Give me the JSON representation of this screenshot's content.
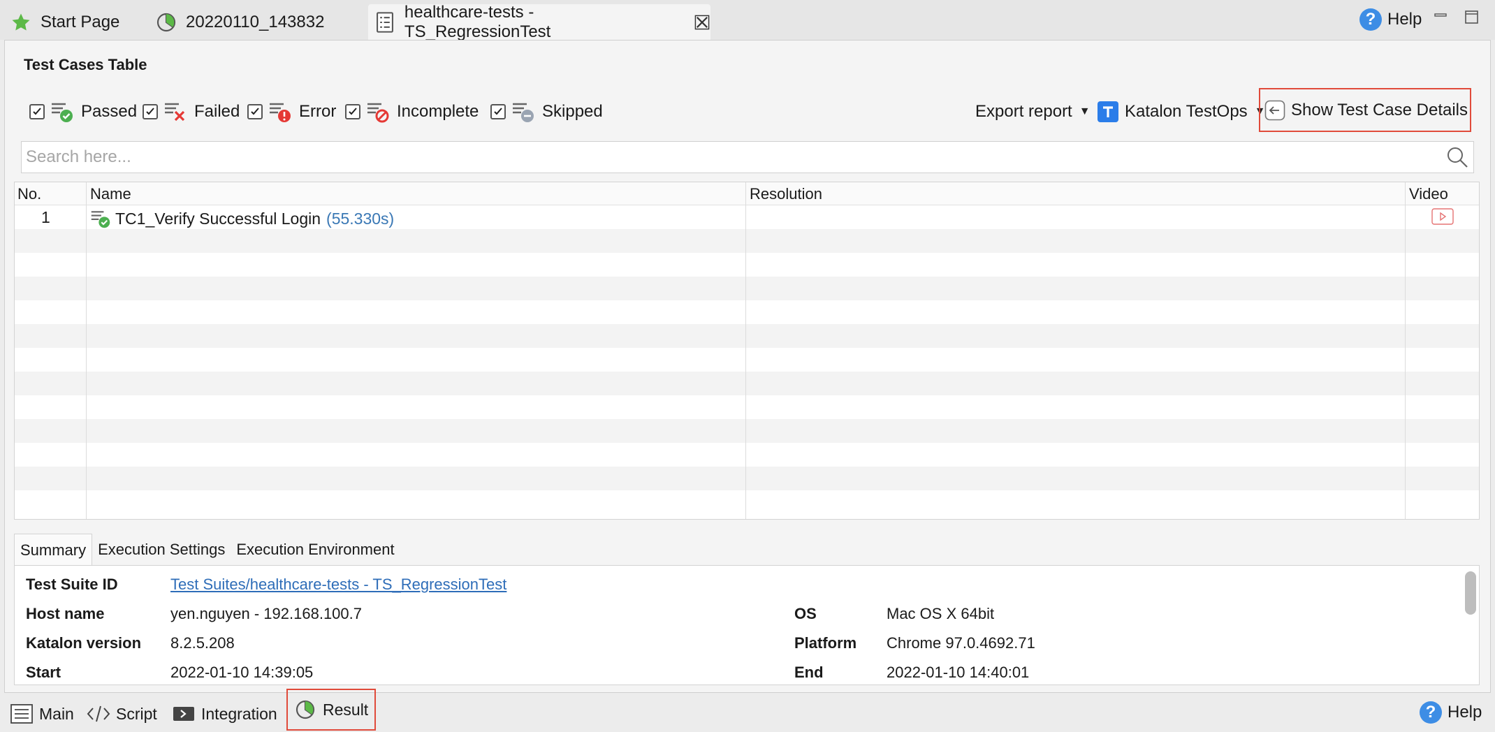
{
  "tabs": [
    {
      "label": "Start Page",
      "icon": "star-icon"
    },
    {
      "label": "20220110_143832",
      "icon": "report-pie-icon"
    },
    {
      "label": "healthcare-tests - TS_RegressionTest",
      "icon": "test-suite-icon",
      "active": true
    }
  ],
  "top_help": "Help",
  "panel_title": "Test Cases Table",
  "filters": [
    {
      "label": "Passed",
      "checked": true
    },
    {
      "label": "Failed",
      "checked": true
    },
    {
      "label": "Error",
      "checked": true
    },
    {
      "label": "Incomplete",
      "checked": true
    },
    {
      "label": "Skipped",
      "checked": true
    }
  ],
  "toolbar": {
    "export": "Export report",
    "testops": "Katalon TestOps",
    "show_details": "Show Test Case Details"
  },
  "search": {
    "placeholder": "Search here..."
  },
  "table": {
    "columns": [
      "No.",
      "Name",
      "Resolution",
      "Video"
    ],
    "rows": [
      {
        "no": "1",
        "name": "TC1_Verify Successful Login",
        "duration": "(55.330s)",
        "status": "passed"
      }
    ]
  },
  "subtabs": [
    "Summary",
    "Execution Settings",
    "Execution Environment"
  ],
  "summary": {
    "test_suite_id_label": "Test Suite ID",
    "test_suite_id": "Test Suites/healthcare-tests - TS_RegressionTest",
    "host_label": "Host name",
    "host": "yen.nguyen - 192.168.100.7",
    "os_label": "OS",
    "os": "Mac OS X 64bit",
    "version_label": "Katalon version",
    "version": "8.2.5.208",
    "platform_label": "Platform",
    "platform": "Chrome 97.0.4692.71",
    "start_label": "Start",
    "start": "2022-01-10 14:39:05",
    "end_label": "End",
    "end": "2022-01-10 14:40:01"
  },
  "bottom_tabs": [
    {
      "label": "Main",
      "icon": "list-icon"
    },
    {
      "label": "Script",
      "icon": "code-icon"
    },
    {
      "label": "Integration",
      "icon": "integration-icon"
    },
    {
      "label": "Result",
      "icon": "report-pie-icon"
    }
  ],
  "bottom_help": "Help",
  "colors": {
    "highlight": "#e04a3a",
    "passed": "#4caf50",
    "failed": "#e53935",
    "link": "#2e6db8"
  }
}
